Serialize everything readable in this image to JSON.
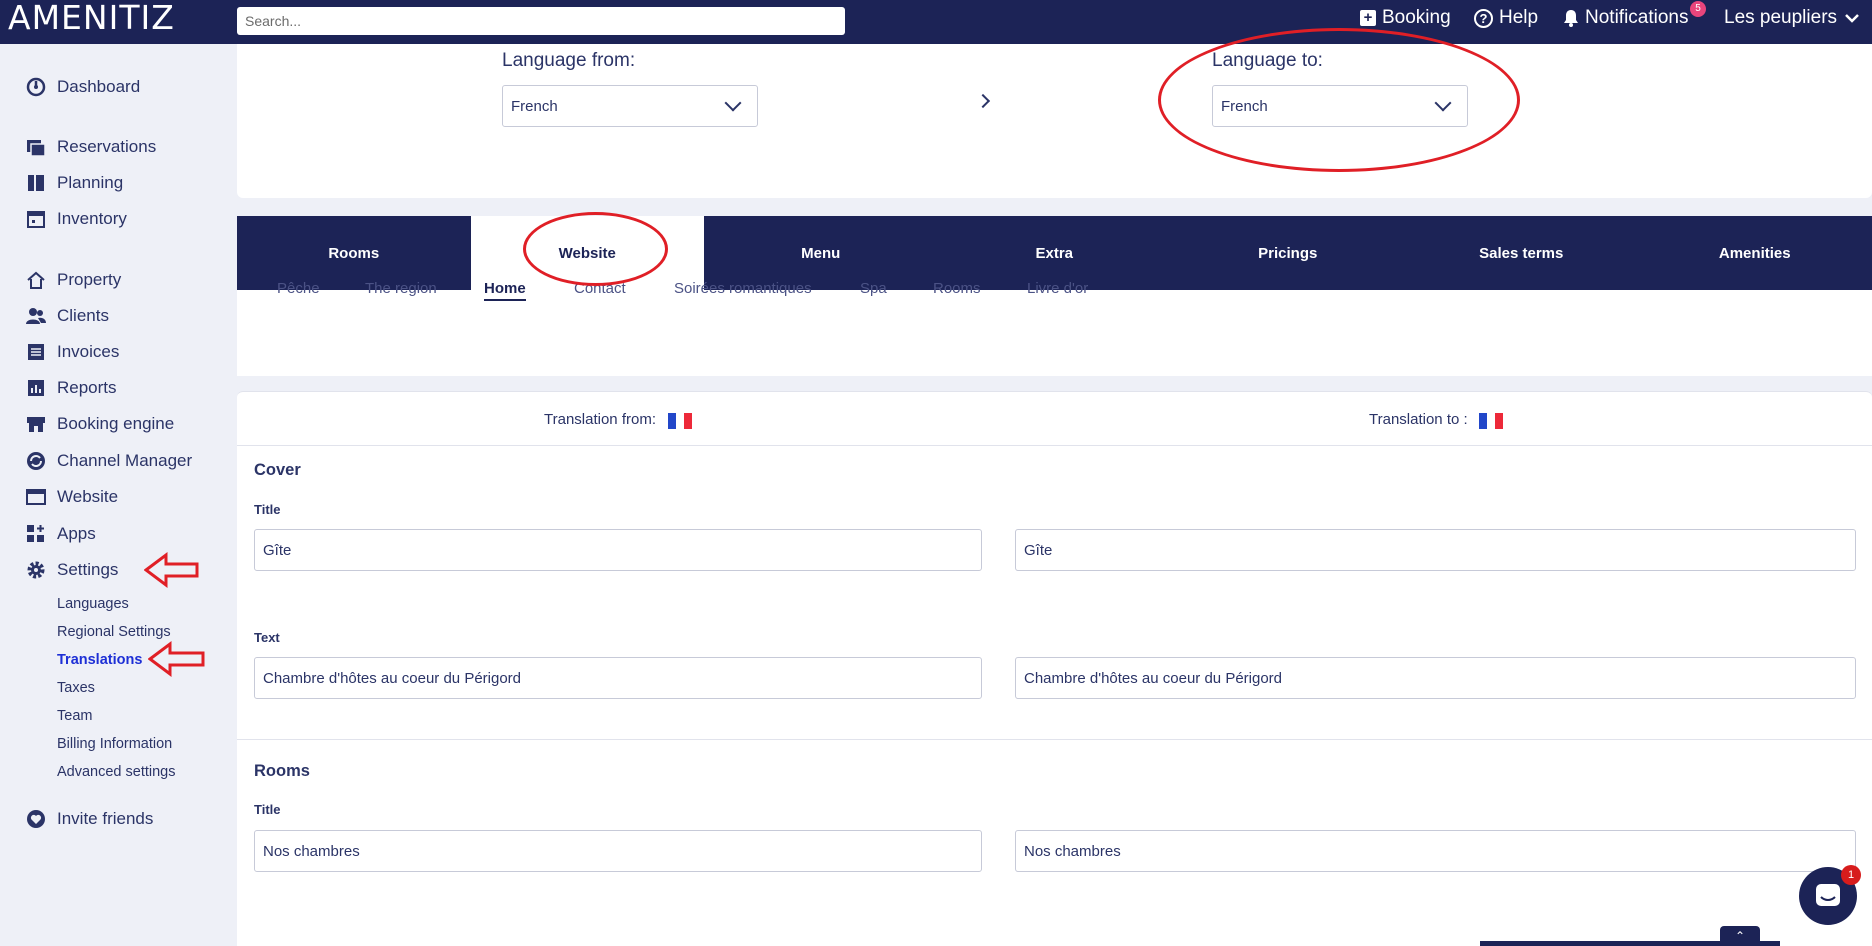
{
  "app": {
    "logo": "AMENITIZ"
  },
  "search": {
    "placeholder": "Search..."
  },
  "topnav": {
    "booking": "Booking",
    "help": "Help",
    "notifications": "Notifications",
    "notifications_count": "5",
    "user": "Les peupliers"
  },
  "sidebar": {
    "items": [
      {
        "label": "Dashboard",
        "icon": "dashboard-icon"
      },
      {
        "label": "Reservations",
        "icon": "reservations-icon"
      },
      {
        "label": "Planning",
        "icon": "planning-icon"
      },
      {
        "label": "Inventory",
        "icon": "inventory-icon"
      },
      {
        "label": "Property",
        "icon": "home-icon"
      },
      {
        "label": "Clients",
        "icon": "clients-icon"
      },
      {
        "label": "Invoices",
        "icon": "invoices-icon"
      },
      {
        "label": "Reports",
        "icon": "reports-icon"
      },
      {
        "label": "Booking engine",
        "icon": "store-icon"
      },
      {
        "label": "Channel Manager",
        "icon": "sync-icon"
      },
      {
        "label": "Website",
        "icon": "browser-icon"
      },
      {
        "label": "Apps",
        "icon": "apps-icon"
      },
      {
        "label": "Settings",
        "icon": "gear-icon"
      },
      {
        "label": "Invite friends",
        "icon": "heart-icon"
      }
    ],
    "settings_sub": [
      "Languages",
      "Regional Settings",
      "Translations",
      "Taxes",
      "Team",
      "Billing Information",
      "Advanced settings"
    ]
  },
  "language": {
    "from_label": "Language from:",
    "from_value": "French",
    "to_label": "Language to:",
    "to_value": "French"
  },
  "tabs": [
    "Rooms",
    "Website",
    "Menu",
    "Extra",
    "Pricings",
    "Sales terms",
    "Amenities"
  ],
  "active_tab": "Website",
  "subtabs": [
    "Pêche",
    "The region",
    "Home",
    "Contact",
    "Soirées romantiques",
    "Spa",
    "Rooms",
    "Livre d'or"
  ],
  "active_subtab": "Home",
  "translation": {
    "from_label": "Translation from:",
    "to_label": "Translation to :",
    "sections": [
      {
        "title": "Cover",
        "fields": [
          {
            "label": "Title",
            "from": "Gîte",
            "to": "Gîte"
          },
          {
            "label": "Text",
            "from": "Chambre d'hôtes au coeur du Périgord",
            "to": "Chambre d'hôtes au coeur du Périgord"
          }
        ]
      },
      {
        "title": "Rooms",
        "fields": [
          {
            "label": "Title",
            "from": "Nos chambres",
            "to": "Nos chambres"
          }
        ]
      }
    ]
  },
  "chat": {
    "badge": "1"
  },
  "colors": {
    "navy": "#1c2356",
    "accent_blue": "#1d2fd6",
    "annotation_red": "#e01f26",
    "badge_pink": "#e8457c"
  }
}
